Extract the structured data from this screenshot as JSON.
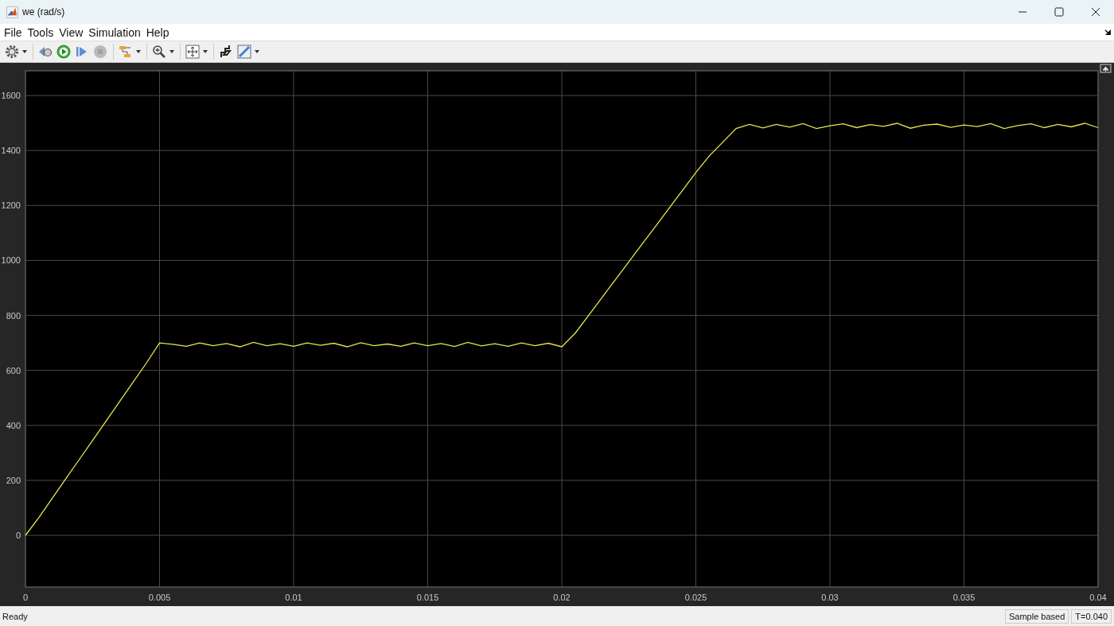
{
  "window": {
    "title": "we (rad/s)"
  },
  "menu": [
    {
      "label": "File"
    },
    {
      "label": "Tools"
    },
    {
      "label": "View"
    },
    {
      "label": "Simulation"
    },
    {
      "label": "Help"
    }
  ],
  "toolbar": [
    {
      "kind": "settings",
      "caret": true,
      "disabled": false
    },
    {
      "kind": "step-back",
      "caret": false,
      "disabled": false
    },
    {
      "kind": "run",
      "caret": false,
      "disabled": false
    },
    {
      "kind": "step-forward",
      "caret": false,
      "disabled": false
    },
    {
      "kind": "stop",
      "caret": false,
      "disabled": true
    },
    {
      "kind": "signal-select",
      "caret": true,
      "disabled": false
    },
    {
      "kind": "zoom",
      "caret": true,
      "disabled": false
    },
    {
      "kind": "fit",
      "caret": true,
      "disabled": false
    },
    {
      "kind": "highlight",
      "caret": false,
      "disabled": false
    },
    {
      "kind": "edit",
      "caret": true,
      "disabled": false
    }
  ],
  "scope": {
    "chart_data": {
      "type": "line",
      "grid": true,
      "xlim": [
        0,
        0.04
      ],
      "ylim": [
        -188,
        1690
      ],
      "xticks": [
        0,
        0.005,
        0.01,
        0.015,
        0.02,
        0.025,
        0.03,
        0.035,
        0.04
      ],
      "yticks": [
        0,
        200,
        400,
        600,
        800,
        1000,
        1200,
        1400,
        1600
      ],
      "x": [
        0,
        0.0005,
        0.001,
        0.0015,
        0.002,
        0.0025,
        0.003,
        0.0035,
        0.004,
        0.0045,
        0.005,
        0.0055,
        0.006,
        0.0065,
        0.007,
        0.0075,
        0.008,
        0.0085,
        0.009,
        0.0095,
        0.01,
        0.0105,
        0.011,
        0.0115,
        0.012,
        0.0125,
        0.013,
        0.0135,
        0.014,
        0.0145,
        0.015,
        0.0155,
        0.016,
        0.0165,
        0.017,
        0.0175,
        0.018,
        0.0185,
        0.019,
        0.0195,
        0.02,
        0.0205,
        0.021,
        0.0215,
        0.022,
        0.0225,
        0.023,
        0.0235,
        0.024,
        0.0245,
        0.025,
        0.0255,
        0.026,
        0.0265,
        0.027,
        0.0275,
        0.028,
        0.0285,
        0.029,
        0.0295,
        0.03,
        0.0305,
        0.031,
        0.0315,
        0.032,
        0.0325,
        0.033,
        0.0335,
        0.034,
        0.0345,
        0.035,
        0.0355,
        0.036,
        0.0365,
        0.037,
        0.0375,
        0.038,
        0.0385,
        0.039,
        0.0395,
        0.04
      ],
      "series": [
        {
          "color": "#e8e84a",
          "values": [
            0,
            65,
            135,
            205,
            275,
            345,
            415,
            485,
            555,
            625,
            700,
            695,
            688,
            700,
            690,
            698,
            686,
            702,
            690,
            697,
            688,
            700,
            691,
            699,
            686,
            701,
            690,
            696,
            688,
            700,
            690,
            698,
            687,
            702,
            689,
            697,
            688,
            700,
            690,
            699,
            686,
            735,
            800,
            865,
            930,
            995,
            1060,
            1125,
            1190,
            1255,
            1320,
            1380,
            1430,
            1480,
            1495,
            1482,
            1495,
            1485,
            1498,
            1480,
            1490,
            1497,
            1483,
            1494,
            1488,
            1499,
            1481,
            1492,
            1496,
            1484,
            1493,
            1487,
            1498,
            1480,
            1491,
            1497,
            1483,
            1495,
            1486,
            1499,
            1483
          ]
        }
      ]
    }
  },
  "status_bar": {
    "message": "Ready",
    "mode": "Sample based",
    "time": "T=0.040"
  }
}
